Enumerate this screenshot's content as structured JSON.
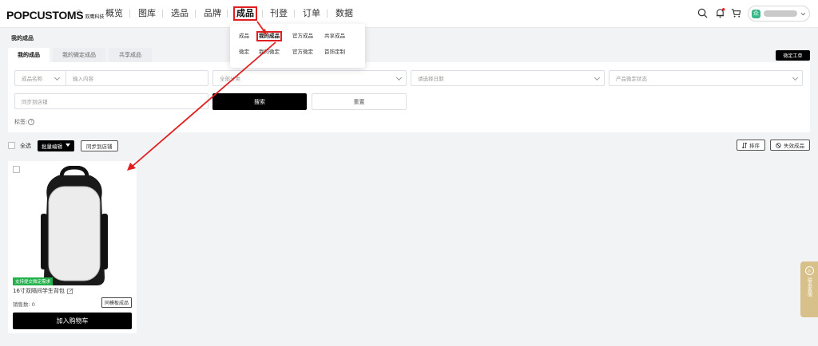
{
  "brand": {
    "logo_text": "POPCUSTOMS",
    "logo_sub": "双鹰科技",
    "logo_cn_top": ".cn"
  },
  "nav": {
    "items": [
      "概览",
      "图库",
      "选品",
      "品牌",
      "成品",
      "刊登",
      "订单",
      "数据"
    ]
  },
  "user": {
    "avatar_letter": "众",
    "name": "用户"
  },
  "dropdown": {
    "row1": [
      "成品",
      "我的成品",
      "官方成品",
      "共享成品"
    ],
    "row2": [
      "微定",
      "我的微定",
      "官方微定",
      "首饰定制"
    ]
  },
  "page": {
    "title": "我的成品"
  },
  "tabs": [
    "我的成品",
    "我的微定成品",
    "共享成品"
  ],
  "custom_order_btn": "微定工单",
  "filters": {
    "name_select": "成品名称",
    "name_input_placeholder": "输入内容",
    "category_placeholder": "全部分类",
    "date_placeholder": "请选择日期",
    "status_placeholder": "产品微定状态",
    "sync_placeholder": "同步到店铺",
    "search_btn": "搜索",
    "reset_btn": "重置",
    "tags_label": "标签:",
    "tags_help": "?"
  },
  "bulk": {
    "select_all": "全选",
    "bulk_edit": "批量编辑",
    "sync": "同步到店铺",
    "sort": "排序",
    "invalid": "失效成品"
  },
  "product": {
    "tag": "支持提交微定需求",
    "name": "16寸双隔间学生背包",
    "sales": "销售数: 0",
    "same_btn": "同模板成品",
    "cart_btn": "加入购物车"
  },
  "side_widget": {
    "icon": "◎",
    "label": "联系客服"
  },
  "colors": {
    "accent_red": "#e02020",
    "tag_green": "#22b14c",
    "widget_gold": "#d8c08a"
  }
}
